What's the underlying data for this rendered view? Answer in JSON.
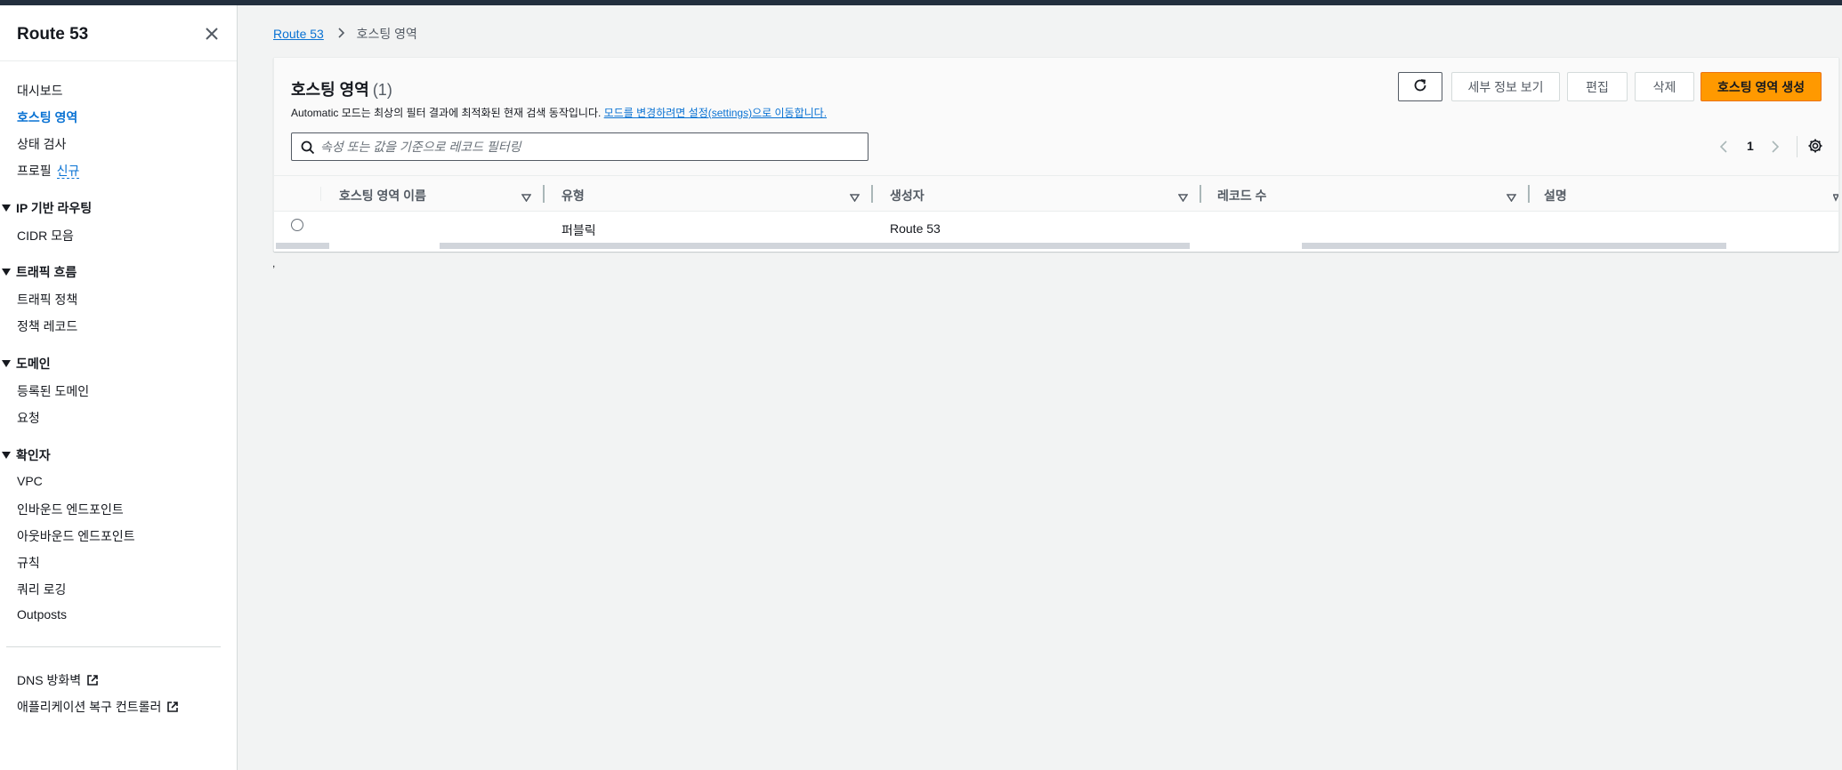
{
  "colors": {
    "link": "#0972d3",
    "primary_button": "#ff9900",
    "topbar": "#232f3e"
  },
  "sidebar": {
    "title": "Route 53",
    "close_icon": "close-icon",
    "items": [
      {
        "label": "대시보드"
      },
      {
        "label": "호스팅 영역",
        "active": true
      },
      {
        "label": "상태 검사"
      },
      {
        "label": "프로필",
        "badge": "신규"
      }
    ],
    "sections": [
      {
        "label": "IP 기반 라우팅",
        "items": [
          "CIDR 모음"
        ]
      },
      {
        "label": "트래픽 흐름",
        "items": [
          "트래픽 정책",
          "정책 레코드"
        ]
      },
      {
        "label": "도메인",
        "items": [
          "등록된 도메인",
          "요청"
        ]
      },
      {
        "label": "확인자",
        "items": [
          "VPC",
          "인바운드 엔드포인트",
          "아웃바운드 엔드포인트",
          "규칙",
          "쿼리 로깅",
          "Outposts"
        ]
      }
    ],
    "external_links": [
      "DNS 방화벽",
      "애플리케이션 복구 컨트롤러"
    ]
  },
  "breadcrumb": {
    "root": "Route 53",
    "current": "호스팅 영역"
  },
  "panel": {
    "title": "호스팅 영역",
    "count": "(1)",
    "description_prefix": "Automatic 모드는 최상의 필터 결과에 최적화된 현재 검색 동작입니다.",
    "description_link": "모드를 변경하려면 설정(settings)으로 이동합니다.",
    "buttons": {
      "refresh_icon": "refresh-icon",
      "details": "세부 정보 보기",
      "edit": "편집",
      "delete": "삭제",
      "create": "호스팅 영역 생성"
    },
    "search": {
      "placeholder": "속성 또는 값을 기준으로 레코드 필터링",
      "value": ""
    },
    "pagination": {
      "current_page": "1"
    },
    "table": {
      "columns": [
        "호스팅 영역 이름",
        "유형",
        "생성자",
        "레코드 수",
        "설명"
      ],
      "rows": [
        {
          "name": "",
          "type": "퍼블릭",
          "created_by": "Route 53",
          "record_count": "",
          "description": ""
        }
      ]
    }
  },
  "stray_text": ","
}
